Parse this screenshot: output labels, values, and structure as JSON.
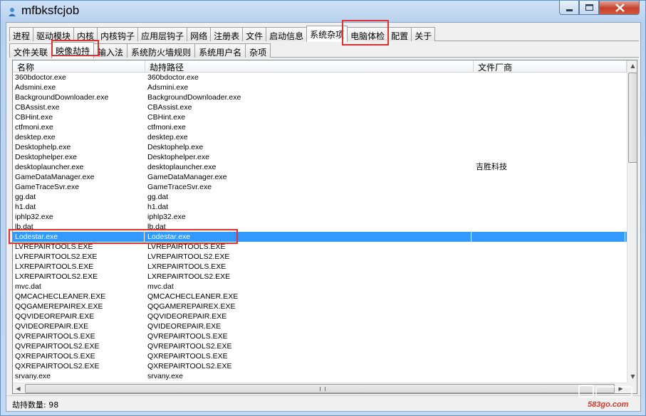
{
  "window": {
    "title": "mfbksfcjob"
  },
  "main_tabs": [
    {
      "label": "进程"
    },
    {
      "label": "驱动模块"
    },
    {
      "label": "内核"
    },
    {
      "label": "内核钩子"
    },
    {
      "label": "应用层钩子"
    },
    {
      "label": "网络"
    },
    {
      "label": "注册表"
    },
    {
      "label": "文件"
    },
    {
      "label": "启动信息"
    },
    {
      "label": "系统杂项",
      "active": true
    },
    {
      "label": "电脑体检"
    },
    {
      "label": "配置"
    },
    {
      "label": "关于"
    }
  ],
  "sub_tabs": [
    {
      "label": "文件关联"
    },
    {
      "label": "映像劫持",
      "active": true
    },
    {
      "label": "输入法"
    },
    {
      "label": "系统防火墙规则"
    },
    {
      "label": "系统用户名"
    },
    {
      "label": "杂项"
    }
  ],
  "table": {
    "columns": [
      "名称",
      "劫持路径",
      "文件厂商"
    ],
    "rows": [
      [
        "360bdoctor.exe",
        "360bdoctor.exe",
        ""
      ],
      [
        "Adsmini.exe",
        "Adsmini.exe",
        ""
      ],
      [
        "BackgroundDownloader.exe",
        "BackgroundDownloader.exe",
        ""
      ],
      [
        "CBAssist.exe",
        "CBAssist.exe",
        ""
      ],
      [
        "CBHint.exe",
        "CBHint.exe",
        ""
      ],
      [
        "ctfmoni.exe",
        "ctfmoni.exe",
        ""
      ],
      [
        "desktep.exe",
        "desktep.exe",
        ""
      ],
      [
        "Desktophelp.exe",
        "Desktophelp.exe",
        ""
      ],
      [
        "Desktophelper.exe",
        "Desktophelper.exe",
        ""
      ],
      [
        "desktoplauncher.exe",
        "desktoplauncher.exe",
        "吉胜科技"
      ],
      [
        "GameDataManager.exe",
        "GameDataManager.exe",
        ""
      ],
      [
        "GameTraceSvr.exe",
        "GameTraceSvr.exe",
        ""
      ],
      [
        "gg.dat",
        "gg.dat",
        ""
      ],
      [
        "h1.dat",
        "h1.dat",
        ""
      ],
      [
        "iphlp32.exe",
        "iphlp32.exe",
        ""
      ],
      [
        "lb.dat",
        "lb.dat",
        ""
      ],
      [
        "Lodestar.exe",
        "Lodestar.exe",
        ""
      ],
      [
        "LVREPAIRTOOLS.EXE",
        "LVREPAIRTOOLS.EXE",
        ""
      ],
      [
        "LVREPAIRTOOLS2.EXE",
        "LVREPAIRTOOLS2.EXE",
        ""
      ],
      [
        "LXREPAIRTOOLS.EXE",
        "LXREPAIRTOOLS.EXE",
        ""
      ],
      [
        "LXREPAIRTOOLS2.EXE",
        "LXREPAIRTOOLS2.EXE",
        ""
      ],
      [
        "mvc.dat",
        "mvc.dat",
        ""
      ],
      [
        "QMCACHECLEANER.EXE",
        "QMCACHECLEANER.EXE",
        ""
      ],
      [
        "QQGAMEREPAIREX.EXE",
        "QQGAMEREPAIREX.EXE",
        ""
      ],
      [
        "QQVIDEOREPAIR.EXE",
        "QQVIDEOREPAIR.EXE",
        ""
      ],
      [
        "QVIDEOREPAIR.EXE",
        "QVIDEOREPAIR.EXE",
        ""
      ],
      [
        "QVREPAIRTOOLS.EXE",
        "QVREPAIRTOOLS.EXE",
        ""
      ],
      [
        "QVREPAIRTOOLS2.EXE",
        "QVREPAIRTOOLS2.EXE",
        ""
      ],
      [
        "QXREPAIRTOOLS.EXE",
        "QXREPAIRTOOLS.EXE",
        ""
      ],
      [
        "QXREPAIRTOOLS2.EXE",
        "QXREPAIRTOOLS2.EXE",
        ""
      ],
      [
        "srvany.exe",
        "srvany.exe",
        ""
      ]
    ],
    "selected_row": 16
  },
  "status": {
    "text": "劫持数量: 98"
  },
  "watermark": {
    "text": "583go.com"
  },
  "colors": {
    "selection": "#3399ff",
    "highlight_box": "#e03030",
    "title_gradient": "#c3d9f1"
  }
}
